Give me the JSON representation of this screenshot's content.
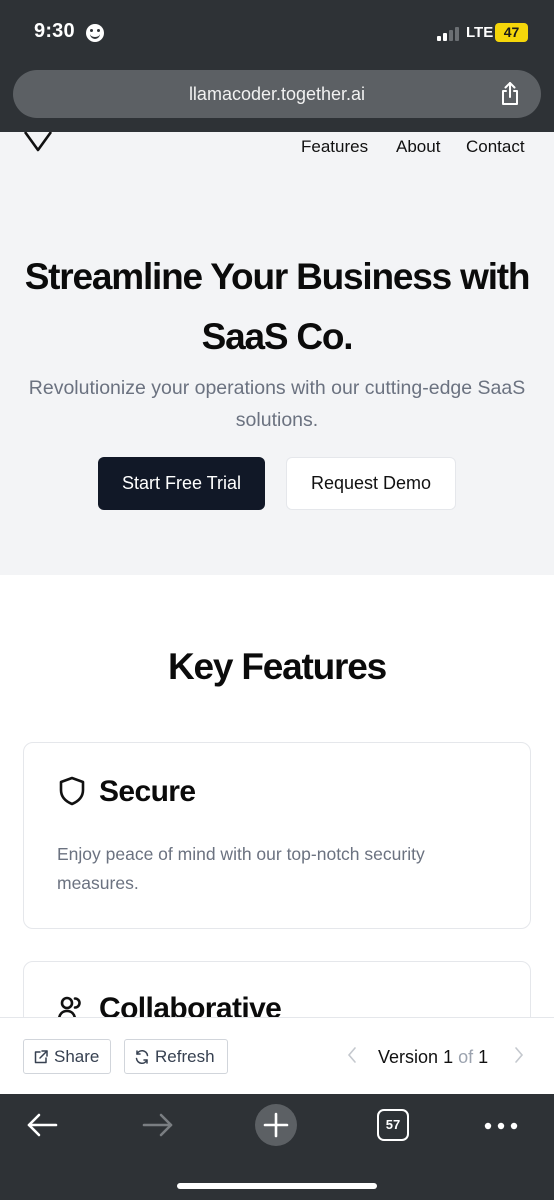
{
  "status_bar": {
    "time": "9:30",
    "network": "LTE",
    "battery": "47"
  },
  "browser": {
    "url": "llamacoder.together.ai",
    "tab_count": "57"
  },
  "site": {
    "nav": {
      "features": "Features",
      "about": "About",
      "contact": "Contact"
    },
    "hero": {
      "title": "Streamline Your Business with SaaS Co.",
      "subtitle": "Revolutionize your operations with our cutting-edge SaaS solutions.",
      "primary_cta": "Start Free Trial",
      "secondary_cta": "Request Demo"
    },
    "features": {
      "title": "Key Features",
      "items": [
        {
          "icon": "shield-icon",
          "title": "Secure",
          "description": "Enjoy peace of mind with our top-notch security measures."
        },
        {
          "icon": "users-icon",
          "title": "Collaborative",
          "description": ""
        }
      ]
    }
  },
  "toolbar": {
    "share_label": "Share",
    "refresh_label": "Refresh",
    "version_label": "Version",
    "version_current": "1",
    "version_of": "of",
    "version_total": "1"
  },
  "colors": {
    "primary_button": "#111827",
    "hero_background": "#f3f4f6",
    "muted_text": "#6b7280",
    "battery": "#f5d60a"
  }
}
